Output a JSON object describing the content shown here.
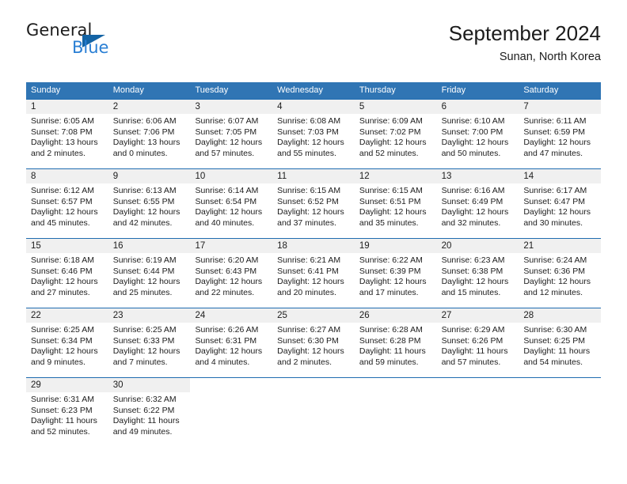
{
  "brand": {
    "name_part1": "General",
    "name_part2": "Blue",
    "triangle_color": "#1464a5",
    "blue_color": "#2a7fd4"
  },
  "header": {
    "title": "September 2024",
    "location": "Sunan, North Korea"
  },
  "theme": {
    "header_bg": "#3075b4",
    "week_divider": "#1f6cb0",
    "daynum_bg": "#f0f0f0"
  },
  "weekdays": [
    "Sunday",
    "Monday",
    "Tuesday",
    "Wednesday",
    "Thursday",
    "Friday",
    "Saturday"
  ],
  "weeks": [
    [
      {
        "day": "1",
        "sunrise": "Sunrise: 6:05 AM",
        "sunset": "Sunset: 7:08 PM",
        "daylight1": "Daylight: 13 hours",
        "daylight2": "and 2 minutes."
      },
      {
        "day": "2",
        "sunrise": "Sunrise: 6:06 AM",
        "sunset": "Sunset: 7:06 PM",
        "daylight1": "Daylight: 13 hours",
        "daylight2": "and 0 minutes."
      },
      {
        "day": "3",
        "sunrise": "Sunrise: 6:07 AM",
        "sunset": "Sunset: 7:05 PM",
        "daylight1": "Daylight: 12 hours",
        "daylight2": "and 57 minutes."
      },
      {
        "day": "4",
        "sunrise": "Sunrise: 6:08 AM",
        "sunset": "Sunset: 7:03 PM",
        "daylight1": "Daylight: 12 hours",
        "daylight2": "and 55 minutes."
      },
      {
        "day": "5",
        "sunrise": "Sunrise: 6:09 AM",
        "sunset": "Sunset: 7:02 PM",
        "daylight1": "Daylight: 12 hours",
        "daylight2": "and 52 minutes."
      },
      {
        "day": "6",
        "sunrise": "Sunrise: 6:10 AM",
        "sunset": "Sunset: 7:00 PM",
        "daylight1": "Daylight: 12 hours",
        "daylight2": "and 50 minutes."
      },
      {
        "day": "7",
        "sunrise": "Sunrise: 6:11 AM",
        "sunset": "Sunset: 6:59 PM",
        "daylight1": "Daylight: 12 hours",
        "daylight2": "and 47 minutes."
      }
    ],
    [
      {
        "day": "8",
        "sunrise": "Sunrise: 6:12 AM",
        "sunset": "Sunset: 6:57 PM",
        "daylight1": "Daylight: 12 hours",
        "daylight2": "and 45 minutes."
      },
      {
        "day": "9",
        "sunrise": "Sunrise: 6:13 AM",
        "sunset": "Sunset: 6:55 PM",
        "daylight1": "Daylight: 12 hours",
        "daylight2": "and 42 minutes."
      },
      {
        "day": "10",
        "sunrise": "Sunrise: 6:14 AM",
        "sunset": "Sunset: 6:54 PM",
        "daylight1": "Daylight: 12 hours",
        "daylight2": "and 40 minutes."
      },
      {
        "day": "11",
        "sunrise": "Sunrise: 6:15 AM",
        "sunset": "Sunset: 6:52 PM",
        "daylight1": "Daylight: 12 hours",
        "daylight2": "and 37 minutes."
      },
      {
        "day": "12",
        "sunrise": "Sunrise: 6:15 AM",
        "sunset": "Sunset: 6:51 PM",
        "daylight1": "Daylight: 12 hours",
        "daylight2": "and 35 minutes."
      },
      {
        "day": "13",
        "sunrise": "Sunrise: 6:16 AM",
        "sunset": "Sunset: 6:49 PM",
        "daylight1": "Daylight: 12 hours",
        "daylight2": "and 32 minutes."
      },
      {
        "day": "14",
        "sunrise": "Sunrise: 6:17 AM",
        "sunset": "Sunset: 6:47 PM",
        "daylight1": "Daylight: 12 hours",
        "daylight2": "and 30 minutes."
      }
    ],
    [
      {
        "day": "15",
        "sunrise": "Sunrise: 6:18 AM",
        "sunset": "Sunset: 6:46 PM",
        "daylight1": "Daylight: 12 hours",
        "daylight2": "and 27 minutes."
      },
      {
        "day": "16",
        "sunrise": "Sunrise: 6:19 AM",
        "sunset": "Sunset: 6:44 PM",
        "daylight1": "Daylight: 12 hours",
        "daylight2": "and 25 minutes."
      },
      {
        "day": "17",
        "sunrise": "Sunrise: 6:20 AM",
        "sunset": "Sunset: 6:43 PM",
        "daylight1": "Daylight: 12 hours",
        "daylight2": "and 22 minutes."
      },
      {
        "day": "18",
        "sunrise": "Sunrise: 6:21 AM",
        "sunset": "Sunset: 6:41 PM",
        "daylight1": "Daylight: 12 hours",
        "daylight2": "and 20 minutes."
      },
      {
        "day": "19",
        "sunrise": "Sunrise: 6:22 AM",
        "sunset": "Sunset: 6:39 PM",
        "daylight1": "Daylight: 12 hours",
        "daylight2": "and 17 minutes."
      },
      {
        "day": "20",
        "sunrise": "Sunrise: 6:23 AM",
        "sunset": "Sunset: 6:38 PM",
        "daylight1": "Daylight: 12 hours",
        "daylight2": "and 15 minutes."
      },
      {
        "day": "21",
        "sunrise": "Sunrise: 6:24 AM",
        "sunset": "Sunset: 6:36 PM",
        "daylight1": "Daylight: 12 hours",
        "daylight2": "and 12 minutes."
      }
    ],
    [
      {
        "day": "22",
        "sunrise": "Sunrise: 6:25 AM",
        "sunset": "Sunset: 6:34 PM",
        "daylight1": "Daylight: 12 hours",
        "daylight2": "and 9 minutes."
      },
      {
        "day": "23",
        "sunrise": "Sunrise: 6:25 AM",
        "sunset": "Sunset: 6:33 PM",
        "daylight1": "Daylight: 12 hours",
        "daylight2": "and 7 minutes."
      },
      {
        "day": "24",
        "sunrise": "Sunrise: 6:26 AM",
        "sunset": "Sunset: 6:31 PM",
        "daylight1": "Daylight: 12 hours",
        "daylight2": "and 4 minutes."
      },
      {
        "day": "25",
        "sunrise": "Sunrise: 6:27 AM",
        "sunset": "Sunset: 6:30 PM",
        "daylight1": "Daylight: 12 hours",
        "daylight2": "and 2 minutes."
      },
      {
        "day": "26",
        "sunrise": "Sunrise: 6:28 AM",
        "sunset": "Sunset: 6:28 PM",
        "daylight1": "Daylight: 11 hours",
        "daylight2": "and 59 minutes."
      },
      {
        "day": "27",
        "sunrise": "Sunrise: 6:29 AM",
        "sunset": "Sunset: 6:26 PM",
        "daylight1": "Daylight: 11 hours",
        "daylight2": "and 57 minutes."
      },
      {
        "day": "28",
        "sunrise": "Sunrise: 6:30 AM",
        "sunset": "Sunset: 6:25 PM",
        "daylight1": "Daylight: 11 hours",
        "daylight2": "and 54 minutes."
      }
    ],
    [
      {
        "day": "29",
        "sunrise": "Sunrise: 6:31 AM",
        "sunset": "Sunset: 6:23 PM",
        "daylight1": "Daylight: 11 hours",
        "daylight2": "and 52 minutes."
      },
      {
        "day": "30",
        "sunrise": "Sunrise: 6:32 AM",
        "sunset": "Sunset: 6:22 PM",
        "daylight1": "Daylight: 11 hours",
        "daylight2": "and 49 minutes."
      },
      {
        "day": "",
        "sunrise": "",
        "sunset": "",
        "daylight1": "",
        "daylight2": ""
      },
      {
        "day": "",
        "sunrise": "",
        "sunset": "",
        "daylight1": "",
        "daylight2": ""
      },
      {
        "day": "",
        "sunrise": "",
        "sunset": "",
        "daylight1": "",
        "daylight2": ""
      },
      {
        "day": "",
        "sunrise": "",
        "sunset": "",
        "daylight1": "",
        "daylight2": ""
      },
      {
        "day": "",
        "sunrise": "",
        "sunset": "",
        "daylight1": "",
        "daylight2": ""
      }
    ]
  ]
}
